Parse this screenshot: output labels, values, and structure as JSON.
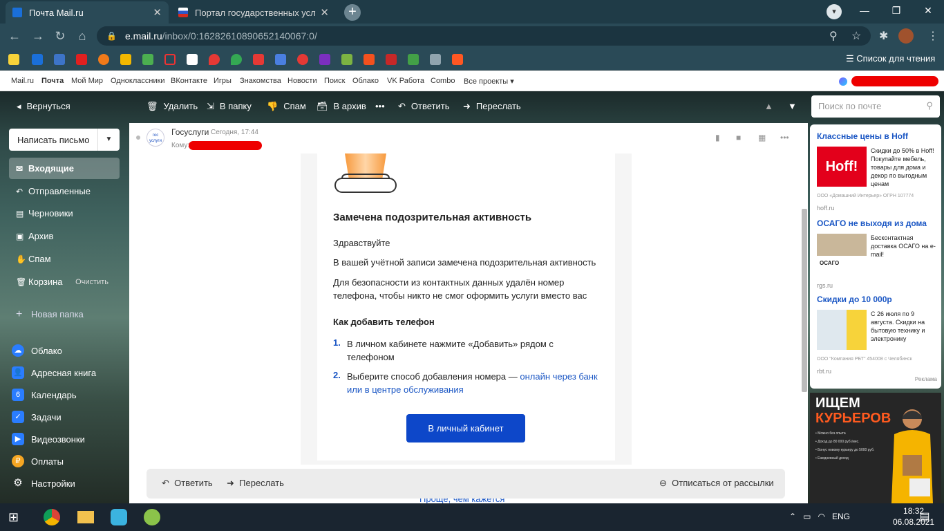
{
  "browser": {
    "tabs": [
      {
        "title": "Почта Mail.ru",
        "favicon": "mail-envelope-icon",
        "active": true
      },
      {
        "title": "Портал государственных услуг",
        "favicon": "russia-flag-icon",
        "active": false
      }
    ],
    "url_host": "e.mail.ru",
    "url_path": "/inbox/0:16282610890652140067:0/",
    "reading_list": "Список для чтения"
  },
  "portal_nav": {
    "links": [
      "Mail.ru",
      "Почта",
      "Мой Мир",
      "Одноклассники",
      "ВКонтакте",
      "Игры",
      "Знакомства",
      "Новости",
      "Поиск",
      "Облако",
      "VK Работа",
      "Combo",
      "Все проекты ▾"
    ]
  },
  "toolbar": {
    "back": "Вернуться",
    "delete": "Удалить",
    "to_folder": "В папку",
    "spam": "Спам",
    "archive": "В архив",
    "more": "•••",
    "reply": "Ответить",
    "forward": "Переслать",
    "search_placeholder": "Поиск по почте"
  },
  "sidebar": {
    "compose": "Написать письмо",
    "folders": [
      {
        "label": "Входящие",
        "icon": "inbox-icon",
        "selected": true
      },
      {
        "label": "Отправленные",
        "icon": "sent-icon"
      },
      {
        "label": "Черновики",
        "icon": "drafts-icon"
      },
      {
        "label": "Архив",
        "icon": "archive-icon"
      },
      {
        "label": "Спам",
        "icon": "spam-icon"
      },
      {
        "label": "Корзина",
        "icon": "trash-icon",
        "extra": "Очистить"
      }
    ],
    "new_folder": "Новая папка",
    "apps": [
      {
        "label": "Облако",
        "icon": "cloud-icon",
        "color": "#2a7dff"
      },
      {
        "label": "Адресная книга",
        "icon": "contacts-icon",
        "color": "#2a7dff"
      },
      {
        "label": "Календарь",
        "icon": "calendar-icon",
        "color": "#2a7dff"
      },
      {
        "label": "Задачи",
        "icon": "tasks-icon",
        "color": "#2a7dff"
      },
      {
        "label": "Видеозвонки",
        "icon": "video-call-icon",
        "color": "#2a7dff"
      },
      {
        "label": "Оплаты",
        "icon": "payments-icon",
        "color": "#f5a623"
      },
      {
        "label": "Настройки",
        "icon": "settings-icon",
        "color": "#ffffff"
      }
    ]
  },
  "message": {
    "sender": "Госуслуги",
    "date": "Сегодня, 17:44",
    "to_label": "Кому:",
    "title": "Замечена подозрительная активность",
    "greeting": "Здравствуйте",
    "p1": "В вашей учётной записи замечена подозрительная активность",
    "p2": "Для безопасности из контактных данных удалён номер телефона, чтобы никто не смог оформить услуги вместо вас",
    "how_title": "Как добавить телефон",
    "steps": [
      {
        "num": "1.",
        "text": "В личном кабинете нажмите «Добавить» рядом с телефоном"
      },
      {
        "num": "2.",
        "text": "Выберите способ добавления номера — ",
        "link": "онлайн через банк или в центре обслуживания"
      }
    ],
    "button": "В личный кабинет",
    "cutoff_text": "Проще, чем кажется"
  },
  "footer_bar": {
    "reply": "Ответить",
    "forward": "Переслать",
    "unsubscribe": "Отписаться от рассылки"
  },
  "ads": [
    {
      "title": "Классные цены в Hoff",
      "text": "Скидки до 50% в Hoff! Покупайте мебель, товары для дома и декор по выгодным ценам",
      "small": "ООО «Домашний Интерьер» ОГРН 107774",
      "domain": "hoff.ru",
      "logo": "Hoff!"
    },
    {
      "title": "ОСАГО не выходя из дома",
      "text": "Бесконтактная доставка ОСАГО на e-mail!",
      "domain": "rgs.ru",
      "img_label": "ОСАГО"
    },
    {
      "title": "Скидки до 10 000р",
      "text": "С 26 июля по 9 августа. Скидки на бытовую технику и электронику",
      "small": "ООО \"Компания РБТ\" 454008 с Челябинск",
      "domain": "rbt.ru"
    }
  ],
  "reklama": "Реклама",
  "banner": {
    "line1": "ИЩЕМ",
    "line2": "КУРЬЕРОВ",
    "bullets": [
      "• Можно без опыта",
      "• Доход до 80 000 руб./мес.",
      "• Бонус новому курьеру до 5000 руб.",
      "• Ежедневный доход"
    ]
  },
  "taskbar": {
    "lang": "ENG",
    "time": "18:32",
    "date": "06.08.2021"
  }
}
